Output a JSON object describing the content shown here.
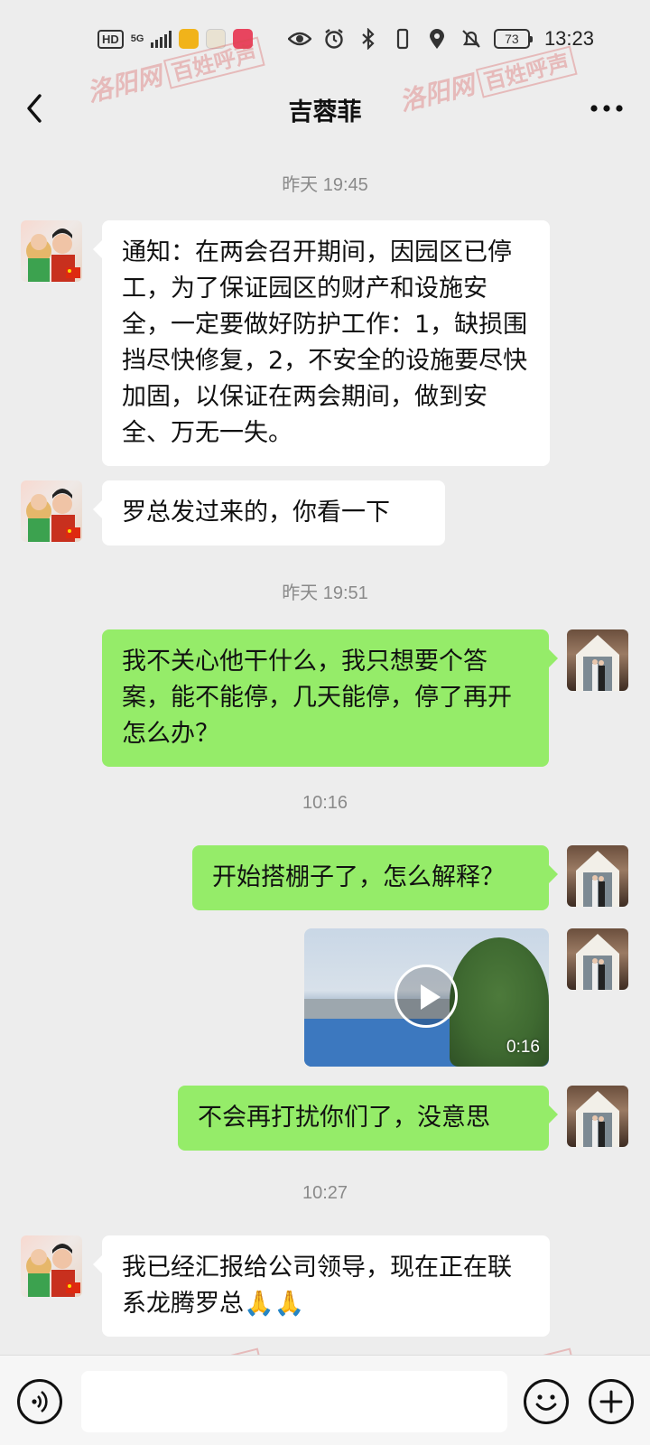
{
  "status_bar": {
    "hd": "HD",
    "network": "5G",
    "battery": "73",
    "time": "13:23"
  },
  "header": {
    "title": "吉蓉菲"
  },
  "watermark": {
    "site": "洛阳网",
    "column": "百姓呼声"
  },
  "messages": [
    {
      "type": "timestamp",
      "text": "昨天 19:45"
    },
    {
      "type": "text",
      "side": "left",
      "text": "通知：在两会召开期间，因园区已停工，为了保证园区的财产和设施安全，一定要做好防护工作：1，缺损围挡尽快修复，2，不安全的设施要尽快加固，以保证在两会期间，做到安全、万无一失。"
    },
    {
      "type": "text",
      "side": "left",
      "text": "罗总发过来的，你看一下"
    },
    {
      "type": "timestamp",
      "text": "昨天 19:51"
    },
    {
      "type": "text",
      "side": "right",
      "text": "我不关心他干什么，我只想要个答案，能不能停，几天能停，停了再开怎么办？"
    },
    {
      "type": "timestamp",
      "text": "10:16"
    },
    {
      "type": "text",
      "side": "right",
      "text": "开始搭棚子了，怎么解释？"
    },
    {
      "type": "video",
      "side": "right",
      "duration": "0:16"
    },
    {
      "type": "text",
      "side": "right",
      "text": "不会再打扰你们了，没意思"
    },
    {
      "type": "timestamp",
      "text": "10:27"
    },
    {
      "type": "text",
      "side": "left",
      "text": "我已经汇报给公司领导，现在正在联系龙腾罗总🙏🙏"
    }
  ],
  "icons": {
    "back": "chevron-left-icon",
    "more": "more-dots-icon",
    "voice": "voice-icon",
    "emoji": "emoji-icon",
    "plus": "plus-icon"
  },
  "colors": {
    "background": "#ededed",
    "outgoing_bubble": "#95ec69",
    "incoming_bubble": "#ffffff",
    "timestamp": "#8a8a8a"
  }
}
